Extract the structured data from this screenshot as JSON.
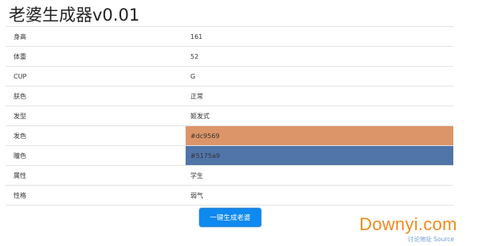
{
  "app": {
    "title": "老婆生成器v0.01"
  },
  "attributes": [
    {
      "label": "身高",
      "value": "161"
    },
    {
      "label": "体重",
      "value": "52"
    },
    {
      "label": "CUP",
      "value": "G"
    },
    {
      "label": "肤色",
      "value": "正常"
    },
    {
      "label": "发型",
      "value": "姬发式"
    },
    {
      "label": "发色",
      "value": "#dc9569",
      "color": "#dc9569"
    },
    {
      "label": "瞳色",
      "value": "#5175a9",
      "color": "#5175a9"
    },
    {
      "label": "属性",
      "value": "学生"
    },
    {
      "label": "性格",
      "value": "弱气"
    }
  ],
  "actions": {
    "generate_label": "一键生成老婆"
  },
  "watermark": {
    "brand": "Downyi.com",
    "subtitle": "讨论地址 Source"
  }
}
